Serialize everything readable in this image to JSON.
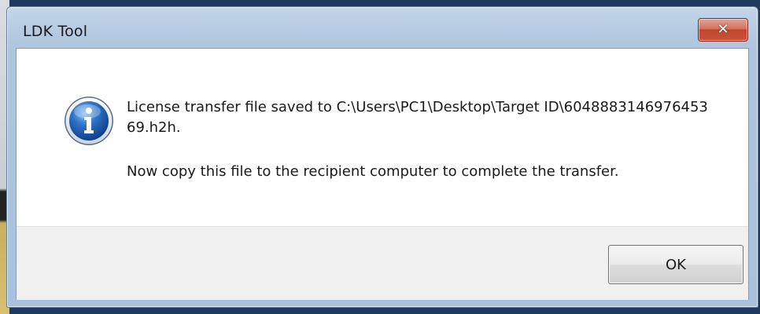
{
  "window": {
    "title": "LDK Tool",
    "close_label": "✕"
  },
  "dialog": {
    "icon": "information-icon",
    "message_line1": "License transfer file saved to C:\\Users\\PC1\\Desktop\\Target ID\\6048883146976453​69.h2h.",
    "message_line2": "Now copy this file to the recipient computer to complete the transfer."
  },
  "buttons": {
    "ok_label": "OK"
  },
  "colors": {
    "title_bar": "#b9cde4",
    "close_button": "#c9533a",
    "footer": "#f0f0f0",
    "info_icon": "#1f5fb4"
  }
}
